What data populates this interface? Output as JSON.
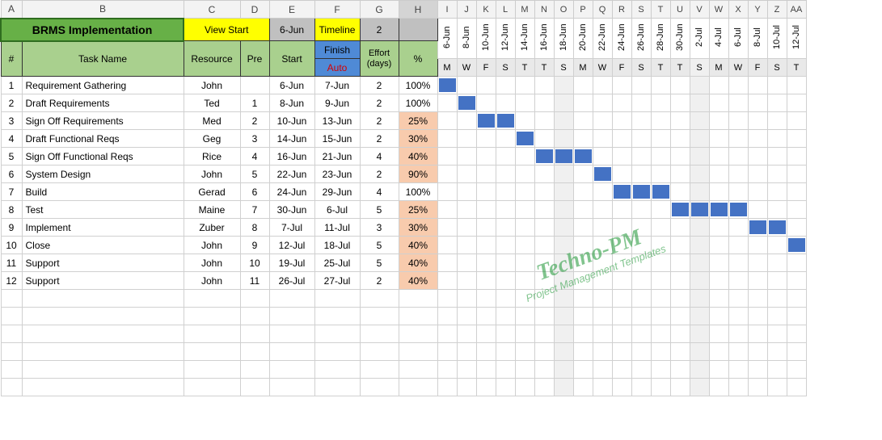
{
  "col_letters": [
    "A",
    "B",
    "C",
    "D",
    "E",
    "F",
    "G",
    "H",
    "I",
    "J",
    "K",
    "L",
    "M",
    "N",
    "O",
    "P",
    "Q",
    "R",
    "S",
    "T",
    "U",
    "V",
    "W",
    "X",
    "Y",
    "Z",
    "AA"
  ],
  "selected_col": 7,
  "title": "BRMS Implementation",
  "row1": {
    "view_start": "View Start",
    "view_start_date": "6-Jun",
    "timeline": "Timeline",
    "timeline_val": "2"
  },
  "headers": {
    "num": "#",
    "task": "Task Name",
    "resource": "Resource",
    "pre": "Pre",
    "start": "Start",
    "finish": "Finish",
    "auto": "Auto",
    "effort": "Effort (days)",
    "pct": "%"
  },
  "dates": [
    "6-Jun",
    "8-Jun",
    "10-Jun",
    "12-Jun",
    "14-Jun",
    "16-Jun",
    "18-Jun",
    "20-Jun",
    "22-Jun",
    "24-Jun",
    "26-Jun",
    "28-Jun",
    "30-Jun",
    "2-Jul",
    "4-Jul",
    "6-Jul",
    "8-Jul",
    "10-Jul",
    "12-Jul"
  ],
  "days": [
    "M",
    "W",
    "F",
    "S",
    "T",
    "T",
    "S",
    "M",
    "W",
    "F",
    "S",
    "T",
    "T",
    "S",
    "M",
    "W",
    "F",
    "S",
    "T"
  ],
  "shade_cols": [
    6,
    13
  ],
  "tasks": [
    {
      "n": "1",
      "name": "Requirement Gathering",
      "res": "John",
      "pre": "",
      "start": "6-Jun",
      "finish": "7-Jun",
      "eff": "2",
      "pct": "100%",
      "peach": false,
      "bar": [
        0
      ]
    },
    {
      "n": "2",
      "name": "Draft  Requirements",
      "res": "Ted",
      "pre": "1",
      "start": "8-Jun",
      "finish": "9-Jun",
      "eff": "2",
      "pct": "100%",
      "peach": false,
      "bar": [
        1
      ]
    },
    {
      "n": "3",
      "name": "Sign Off  Requirements",
      "res": "Med",
      "pre": "2",
      "start": "10-Jun",
      "finish": "13-Jun",
      "eff": "2",
      "pct": "25%",
      "peach": true,
      "bar": [
        2,
        3
      ]
    },
    {
      "n": "4",
      "name": "Draft Functional Reqs",
      "res": "Geg",
      "pre": "3",
      "start": "14-Jun",
      "finish": "15-Jun",
      "eff": "2",
      "pct": "30%",
      "peach": true,
      "bar": [
        4
      ]
    },
    {
      "n": "5",
      "name": "Sign Off Functional Reqs",
      "res": "Rice",
      "pre": "4",
      "start": "16-Jun",
      "finish": "21-Jun",
      "eff": "4",
      "pct": "40%",
      "peach": true,
      "bar": [
        5,
        6,
        7
      ]
    },
    {
      "n": "6",
      "name": "System Design",
      "res": "John",
      "pre": "5",
      "start": "22-Jun",
      "finish": "23-Jun",
      "eff": "2",
      "pct": "90%",
      "peach": true,
      "bar": [
        8
      ]
    },
    {
      "n": "7",
      "name": "Build",
      "res": "Gerad",
      "pre": "6",
      "start": "24-Jun",
      "finish": "29-Jun",
      "eff": "4",
      "pct": "100%",
      "peach": false,
      "bar": [
        9,
        10,
        11
      ]
    },
    {
      "n": "8",
      "name": "Test",
      "res": "Maine",
      "pre": "7",
      "start": "30-Jun",
      "finish": "6-Jul",
      "eff": "5",
      "pct": "25%",
      "peach": true,
      "bar": [
        12,
        13,
        14,
        15
      ]
    },
    {
      "n": "9",
      "name": "Implement",
      "res": "Zuber",
      "pre": "8",
      "start": "7-Jul",
      "finish": "11-Jul",
      "eff": "3",
      "pct": "30%",
      "peach": true,
      "bar": [
        16,
        17
      ]
    },
    {
      "n": "10",
      "name": "Close",
      "res": "John",
      "pre": "9",
      "start": "12-Jul",
      "finish": "18-Jul",
      "eff": "5",
      "pct": "40%",
      "peach": true,
      "bar": [
        18
      ]
    },
    {
      "n": "11",
      "name": "Support",
      "res": "John",
      "pre": "10",
      "start": "19-Jul",
      "finish": "25-Jul",
      "eff": "5",
      "pct": "40%",
      "peach": true,
      "bar": []
    },
    {
      "n": "12",
      "name": "Support",
      "res": "John",
      "pre": "11",
      "start": "26-Jul",
      "finish": "27-Jul",
      "eff": "2",
      "pct": "40%",
      "peach": true,
      "bar": []
    }
  ],
  "blank_rows": 6,
  "watermark": {
    "title": "Techno-PM",
    "sub": "Project Management Templates"
  },
  "chart_data": {
    "type": "gantt",
    "title": "BRMS Implementation",
    "x_dates": [
      "6-Jun",
      "8-Jun",
      "10-Jun",
      "12-Jun",
      "14-Jun",
      "16-Jun",
      "18-Jun",
      "20-Jun",
      "22-Jun",
      "24-Jun",
      "26-Jun",
      "28-Jun",
      "30-Jun",
      "2-Jul",
      "4-Jul",
      "6-Jul",
      "8-Jul",
      "10-Jul",
      "12-Jul"
    ],
    "tasks": [
      {
        "id": 1,
        "name": "Requirement Gathering",
        "resource": "John",
        "predecessor": null,
        "start": "6-Jun",
        "finish": "7-Jun",
        "effort_days": 2,
        "pct_complete": 100
      },
      {
        "id": 2,
        "name": "Draft Requirements",
        "resource": "Ted",
        "predecessor": 1,
        "start": "8-Jun",
        "finish": "9-Jun",
        "effort_days": 2,
        "pct_complete": 100
      },
      {
        "id": 3,
        "name": "Sign Off Requirements",
        "resource": "Med",
        "predecessor": 2,
        "start": "10-Jun",
        "finish": "13-Jun",
        "effort_days": 2,
        "pct_complete": 25
      },
      {
        "id": 4,
        "name": "Draft Functional Reqs",
        "resource": "Geg",
        "predecessor": 3,
        "start": "14-Jun",
        "finish": "15-Jun",
        "effort_days": 2,
        "pct_complete": 30
      },
      {
        "id": 5,
        "name": "Sign Off Functional Reqs",
        "resource": "Rice",
        "predecessor": 4,
        "start": "16-Jun",
        "finish": "21-Jun",
        "effort_days": 4,
        "pct_complete": 40
      },
      {
        "id": 6,
        "name": "System Design",
        "resource": "John",
        "predecessor": 5,
        "start": "22-Jun",
        "finish": "23-Jun",
        "effort_days": 2,
        "pct_complete": 90
      },
      {
        "id": 7,
        "name": "Build",
        "resource": "Gerad",
        "predecessor": 6,
        "start": "24-Jun",
        "finish": "29-Jun",
        "effort_days": 4,
        "pct_complete": 100
      },
      {
        "id": 8,
        "name": "Test",
        "resource": "Maine",
        "predecessor": 7,
        "start": "30-Jun",
        "finish": "6-Jul",
        "effort_days": 5,
        "pct_complete": 25
      },
      {
        "id": 9,
        "name": "Implement",
        "resource": "Zuber",
        "predecessor": 8,
        "start": "7-Jul",
        "finish": "11-Jul",
        "effort_days": 3,
        "pct_complete": 30
      },
      {
        "id": 10,
        "name": "Close",
        "resource": "John",
        "predecessor": 9,
        "start": "12-Jul",
        "finish": "18-Jul",
        "effort_days": 5,
        "pct_complete": 40
      },
      {
        "id": 11,
        "name": "Support",
        "resource": "John",
        "predecessor": 10,
        "start": "19-Jul",
        "finish": "25-Jul",
        "effort_days": 5,
        "pct_complete": 40
      },
      {
        "id": 12,
        "name": "Support",
        "resource": "John",
        "predecessor": 11,
        "start": "26-Jul",
        "finish": "27-Jul",
        "effort_days": 2,
        "pct_complete": 40
      }
    ]
  }
}
